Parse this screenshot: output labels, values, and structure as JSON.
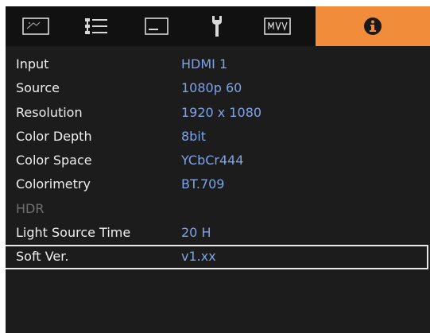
{
  "tabs": [
    {
      "icon": "picture-icon",
      "active": false
    },
    {
      "icon": "settings-list-icon",
      "active": false
    },
    {
      "icon": "display-icon",
      "active": false
    },
    {
      "icon": "wrench-icon",
      "active": false
    },
    {
      "icon": "network-icon",
      "active": false
    },
    {
      "icon": "info-icon",
      "active": true
    }
  ],
  "colors": {
    "active_tab": "#f08c3a",
    "value_text": "#7fa3e6",
    "label_text": "#eeeeee",
    "disabled_text": "#6f6f6f",
    "panel_bg": "#1c1c1c"
  },
  "info_rows": [
    {
      "label": "Input",
      "value": "HDMI 1"
    },
    {
      "label": "Source",
      "value": "1080p 60"
    },
    {
      "label": "Resolution",
      "value": "1920 x 1080"
    },
    {
      "label": "Color Depth",
      "value": "8bit"
    },
    {
      "label": "Color Space",
      "value": "YCbCr444"
    },
    {
      "label": "Colorimetry",
      "value": "BT.709"
    },
    {
      "label": "HDR",
      "value": ""
    },
    {
      "label": "Light Source Time",
      "value": "20 H"
    },
    {
      "label": "Soft Ver.",
      "value": "v1.xx"
    }
  ]
}
